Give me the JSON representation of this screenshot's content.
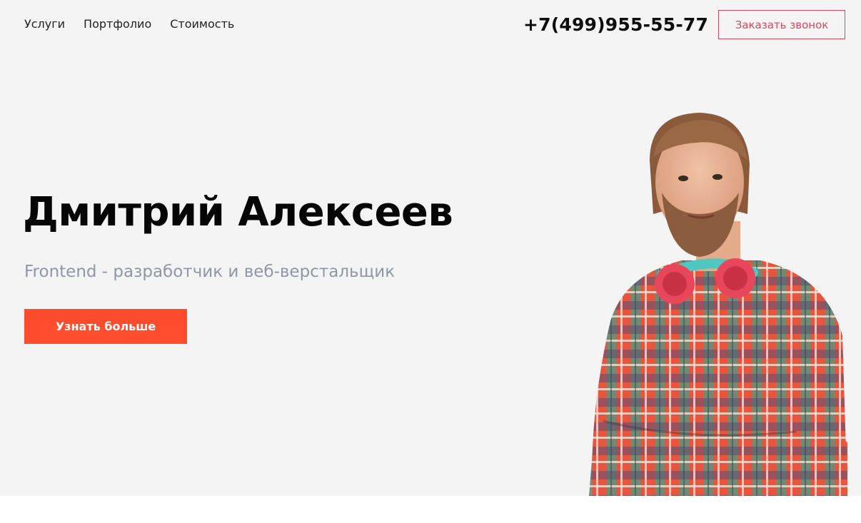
{
  "header": {
    "nav": [
      {
        "label": "Услуги"
      },
      {
        "label": "Портфолио"
      },
      {
        "label": "Стоимость"
      }
    ],
    "phone": "+7(499)955-55-77",
    "callback_label": "Заказать звонок"
  },
  "hero": {
    "title": "Дмитрий Алексеев",
    "subtitle": "Frontend - разработчик и веб-верстальщик",
    "cta_label": "Узнать больше",
    "photo_icon": "person-portrait-photo"
  },
  "colors": {
    "accent": "#ff4c2c",
    "callback_border": "#d94a5e",
    "subtitle": "#8f96a8",
    "hero_background": "#f4f4f4"
  }
}
